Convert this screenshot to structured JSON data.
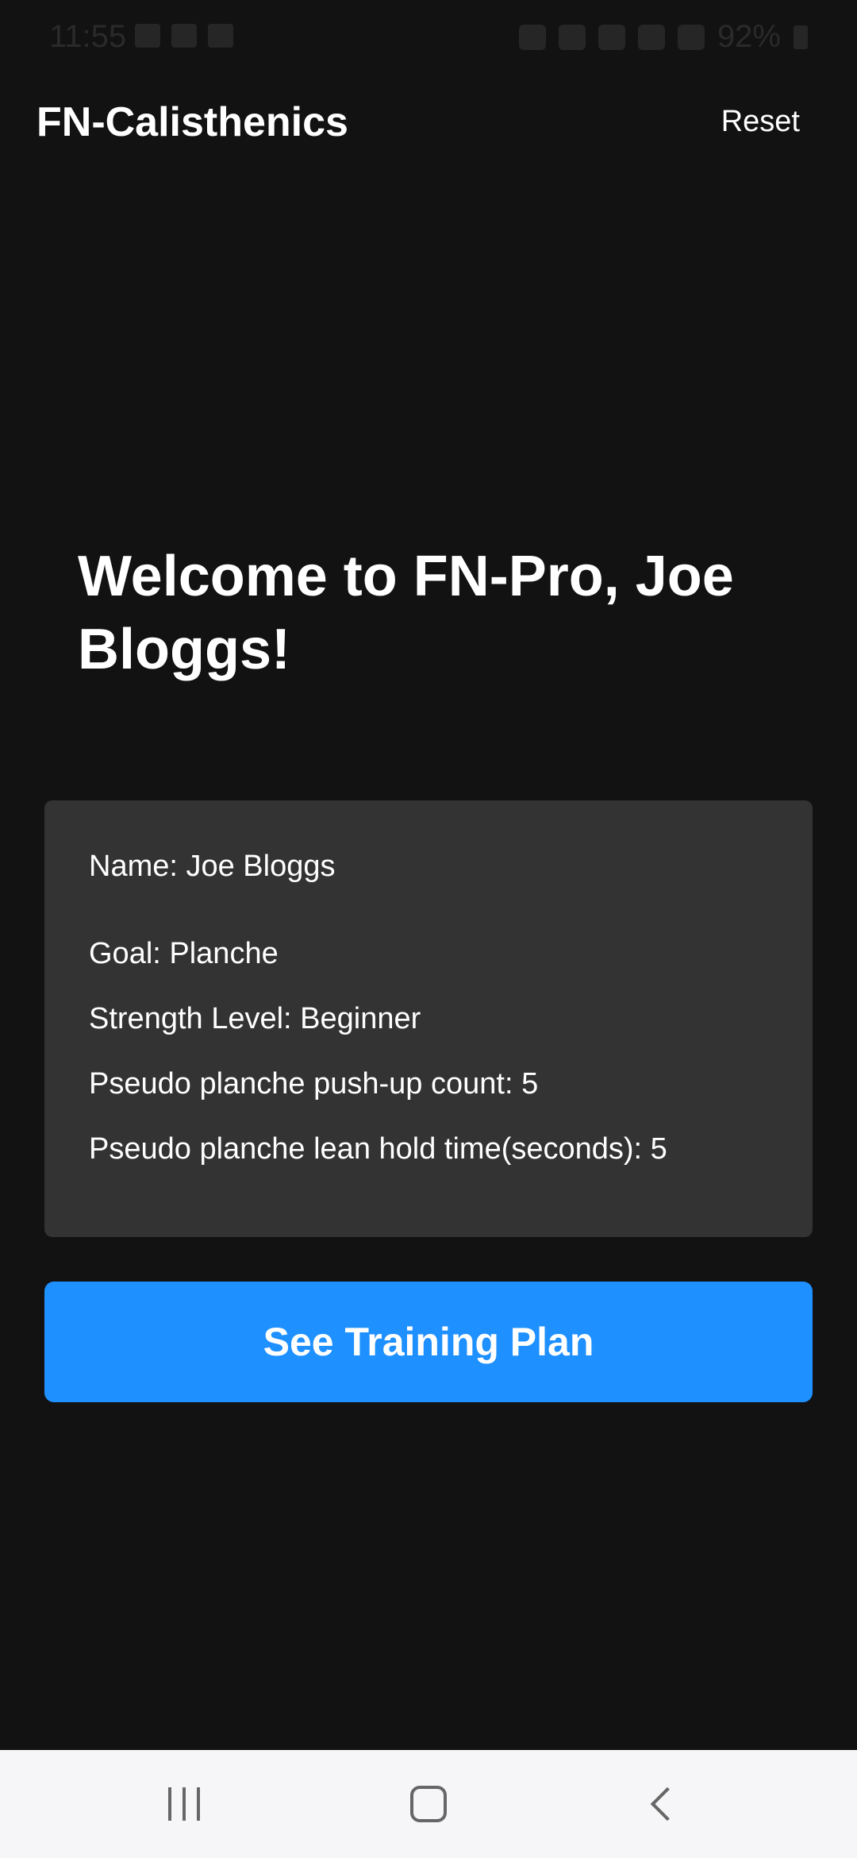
{
  "status_bar": {
    "time": "11:55",
    "battery": "92%"
  },
  "app_bar": {
    "title": "FN-Calisthenics",
    "reset_label": "Reset"
  },
  "welcome": {
    "heading": "Welcome to FN-Pro, Joe Bloggs!"
  },
  "profile": {
    "name": "Name: Joe Bloggs",
    "goal": "Goal: Planche",
    "strength_level": "Strength Level: Beginner",
    "pushup_count": "Pseudo planche push-up count: 5",
    "lean_hold_time": "Pseudo planche lean hold time(seconds): 5"
  },
  "actions": {
    "see_plan_label": "See Training Plan"
  },
  "colors": {
    "background": "#121212",
    "card": "#333333",
    "accent": "#1e90ff",
    "nav_bar": "#f6f6f8"
  },
  "icons": {
    "nav": [
      "recents-icon",
      "home-icon",
      "back-icon"
    ]
  }
}
